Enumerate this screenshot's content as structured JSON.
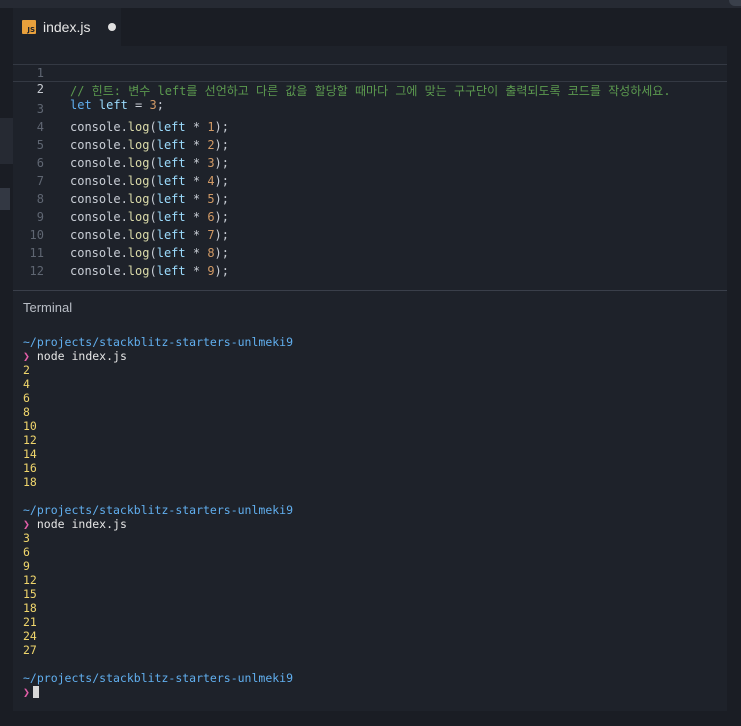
{
  "tab": {
    "filename": "index.js",
    "icon_text": "JS"
  },
  "editor": {
    "lines": [
      {
        "num": "1",
        "comment": "// 힌트: 변수 left를 선언하고 다른 값을 할당할 때마다 그에 맞는 구구단이 출력되도록 코드를 작성하세요."
      },
      {
        "num": "2",
        "kw": "let",
        "var": " left",
        "op": " = ",
        "val": "3",
        "end": ";"
      },
      {
        "num": "3",
        "obj": "console.",
        "fn": "log",
        "open": "(",
        "var": "left",
        "op": " * ",
        "val": "1",
        "end": ");"
      },
      {
        "num": "4",
        "obj": "console.",
        "fn": "log",
        "open": "(",
        "var": "left",
        "op": " * ",
        "val": "2",
        "end": ");"
      },
      {
        "num": "5",
        "obj": "console.",
        "fn": "log",
        "open": "(",
        "var": "left",
        "op": " * ",
        "val": "3",
        "end": ");"
      },
      {
        "num": "6",
        "obj": "console.",
        "fn": "log",
        "open": "(",
        "var": "left",
        "op": " * ",
        "val": "4",
        "end": ");"
      },
      {
        "num": "7",
        "obj": "console.",
        "fn": "log",
        "open": "(",
        "var": "left",
        "op": " * ",
        "val": "5",
        "end": ");"
      },
      {
        "num": "8",
        "obj": "console.",
        "fn": "log",
        "open": "(",
        "var": "left",
        "op": " * ",
        "val": "6",
        "end": ");"
      },
      {
        "num": "9",
        "obj": "console.",
        "fn": "log",
        "open": "(",
        "var": "left",
        "op": " * ",
        "val": "7",
        "end": ");"
      },
      {
        "num": "10",
        "obj": "console.",
        "fn": "log",
        "open": "(",
        "var": "left",
        "op": " * ",
        "val": "8",
        "end": ");"
      },
      {
        "num": "11",
        "obj": "console.",
        "fn": "log",
        "open": "(",
        "var": "left",
        "op": " * ",
        "val": "9",
        "end": ");"
      },
      {
        "num": "12"
      }
    ]
  },
  "terminal": {
    "title": "Terminal",
    "path": "~/projects/stackblitz-starters-unlmeki9",
    "prompt_symbol": "❯",
    "command": "node index.js",
    "runs": [
      {
        "outputs": [
          "2",
          "4",
          "6",
          "8",
          "10",
          "12",
          "14",
          "16",
          "18"
        ]
      },
      {
        "outputs": [
          "3",
          "6",
          "9",
          "12",
          "15",
          "18",
          "21",
          "24",
          "27"
        ]
      }
    ]
  },
  "colors": {
    "background": "#1e222a",
    "comment": "#5c9a4f",
    "keyword": "#61afef",
    "function": "#dcdcaa",
    "number": "#d19a66",
    "terminal_path": "#61afef",
    "terminal_prompt": "#e35ea8",
    "terminal_output": "#f0d66c",
    "js_icon": "#e8a03c"
  }
}
